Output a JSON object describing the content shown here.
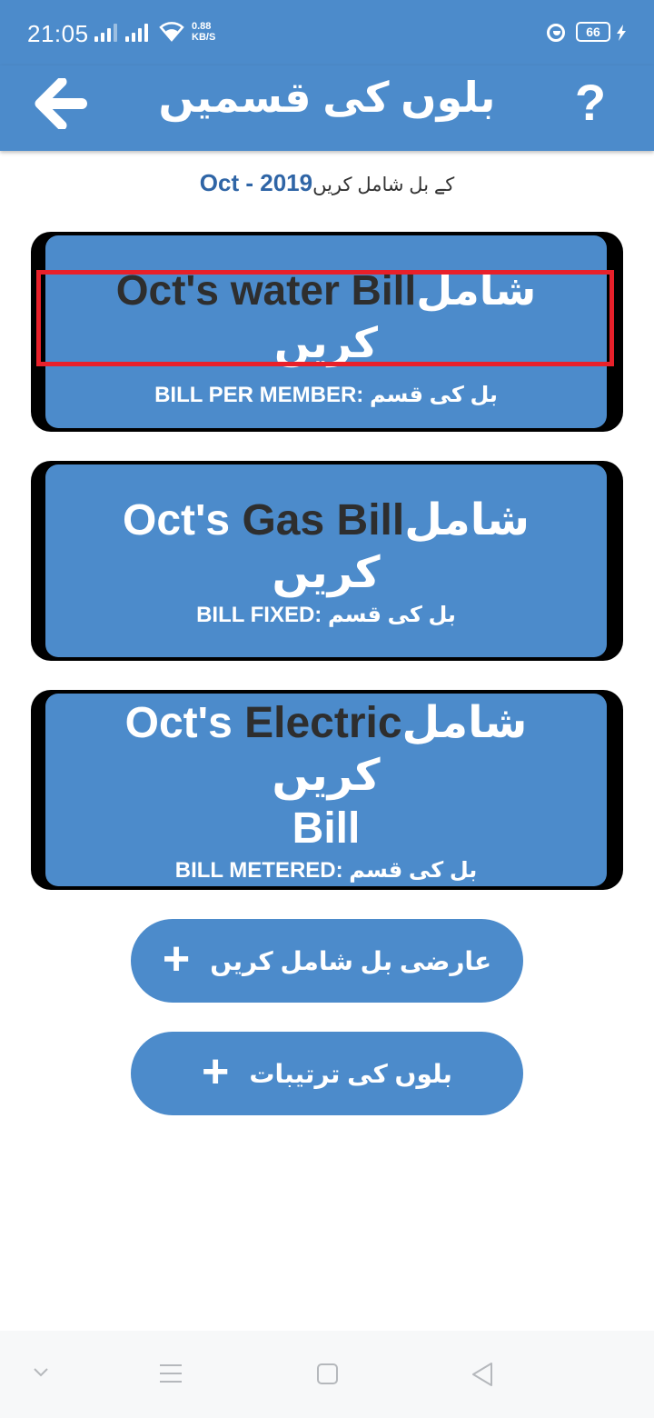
{
  "status_bar": {
    "time": "21:05",
    "net_speed_value": "0.88",
    "net_speed_unit": "KB/S",
    "battery": "66",
    "icons": [
      "signal-icon",
      "signal-icon",
      "wifi-icon",
      "dnd-icon",
      "battery-icon",
      "charging-bolt-icon"
    ]
  },
  "app_bar": {
    "title": "بلوں کی قسمیں",
    "back_icon": "arrow-left-icon",
    "help_icon": "question-icon",
    "help_label": "?"
  },
  "subtitle": {
    "month": "Oct - 2019",
    "suffix": "کے بل شامل کریں"
  },
  "bills": [
    {
      "action": "شامل کریں",
      "name": "Oct's water Bill",
      "type_label": "بل کی قسم",
      "type_value": "BILL PER MEMBER:"
    },
    {
      "action": "شامل کریں",
      "name_dark": "Oct's Gas Bill",
      "type_label": "بل کی قسم",
      "type_value": "BILL FIXED:"
    },
    {
      "action": "شامل کریں",
      "name_white": "Oct's ",
      "name_dark": "Electric",
      "name_line2": "Bill",
      "type_label": "بل کی قسم",
      "type_value": "BILL METERED:"
    }
  ],
  "buttons": {
    "add_temp_bill": "عارضی بل شامل کریں",
    "bill_settings": "بلوں کی ترتیبات",
    "plus_icon": "plus-icon",
    "plus_glyph": "+"
  },
  "nav_bar": {
    "items": [
      "chevron-down-icon",
      "menu-icon",
      "home-square-icon",
      "back-triangle-icon"
    ]
  },
  "colors": {
    "primary": "#4c8bcb",
    "month_text": "#2f65a6",
    "dark_text": "#2e2e2e",
    "highlight": "#e8202a"
  }
}
